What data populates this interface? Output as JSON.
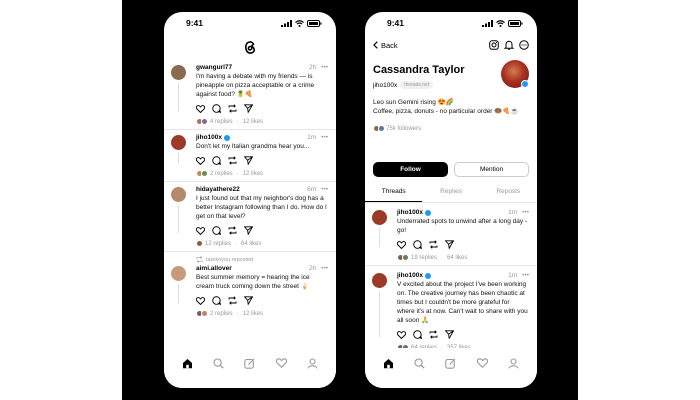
{
  "colors": {
    "accent": "#000000",
    "verified": "#1d9bf0",
    "muted": "#999999"
  },
  "left": {
    "status_time": "9:41",
    "logo_icon": "threads-logo-icon",
    "posts": [
      {
        "user": "gwangurl77",
        "verified": false,
        "time": "2h",
        "text": "I'm having a debate with my friends — is pineapple on pizza acceptable or a crime against food? 🍍🍕",
        "replies": "4 replies",
        "likes": "12 likes",
        "avatar_color": "#8a6a4e"
      },
      {
        "user": "jiho100x",
        "verified": true,
        "time": "1m",
        "text": "Don't let my Italian grandma hear you...",
        "replies": "2 replies",
        "likes": "12 likes",
        "avatar_color": "#9b3a26"
      },
      {
        "user": "hidayathere22",
        "verified": false,
        "time": "6m",
        "text": "I just found out that my neighbor's dog has a better Instagram following than I do. How do I get on that level?",
        "replies": "12 replies",
        "likes": "64 likes",
        "avatar_color": "#b58a6a"
      },
      {
        "reposter": "tarekoyou reposted",
        "user": "aimi.allover",
        "verified": false,
        "time": "2h",
        "text": "Best summer memory = hearing the ice cream truck coming down the street 🍦",
        "replies": "2 replies",
        "likes": "12 likes",
        "avatar_color": "#c99a7a"
      }
    ]
  },
  "right": {
    "status_time": "9:41",
    "back_label": "Back",
    "name": "Cassandra Taylor",
    "handle": "jiho100x",
    "domain_pill": "threads.net",
    "bio_line1": "Leo sun Gemini rising 😍🌈",
    "bio_line2": "Coffee, pizza, donuts - no particular order 🍩🍕☕",
    "followers": "75k followers",
    "follow_label": "Follow",
    "mention_label": "Mention",
    "tabs": [
      "Threads",
      "Replies",
      "Reposts"
    ],
    "posts": [
      {
        "user": "jiho100x",
        "verified": true,
        "time": "1m",
        "text": "Underrated spots to unwind after a long day - go!",
        "replies": "19 replies",
        "likes": "64 likes"
      },
      {
        "user": "jiho100x",
        "verified": true,
        "time": "1m",
        "text": "V excited about the project I've been working on. The creative journey has been chaotic at times but I couldn't be more grateful for where it's at now. Can't wait to share with you all soon 🙏",
        "replies": "64 replies",
        "likes": "357 likes"
      }
    ]
  },
  "tabbar_icons": [
    "home-icon",
    "search-icon",
    "compose-icon",
    "heart-icon",
    "profile-icon"
  ]
}
